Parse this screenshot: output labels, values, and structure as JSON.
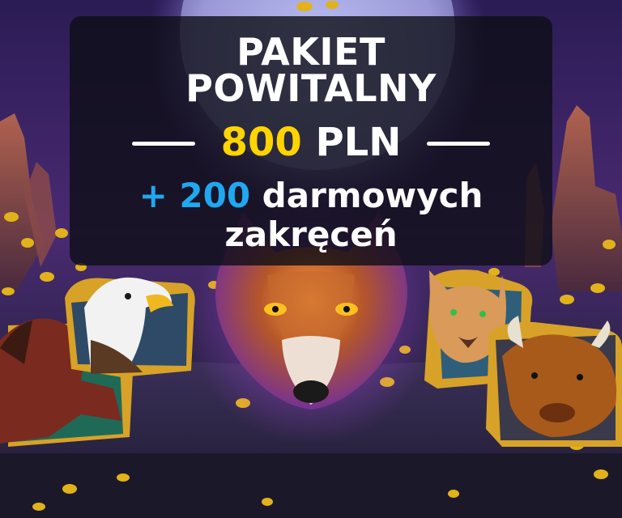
{
  "headline": {
    "line1": "PAKIET",
    "line2": "POWITALNY"
  },
  "amount": {
    "value": "800",
    "currency": "PLN"
  },
  "bonus": {
    "plus": "+ 200",
    "line1_rest": " darmowych",
    "line2": "zakręceń"
  },
  "colors": {
    "amount": "#ffd400",
    "bonus_number": "#1fa8f0",
    "text": "#ffffff",
    "panel": "#0e0e16"
  },
  "illustration": {
    "animals": [
      "horse",
      "eagle",
      "wolf",
      "cougar",
      "bison"
    ],
    "moon": true,
    "gold_coins": true
  }
}
